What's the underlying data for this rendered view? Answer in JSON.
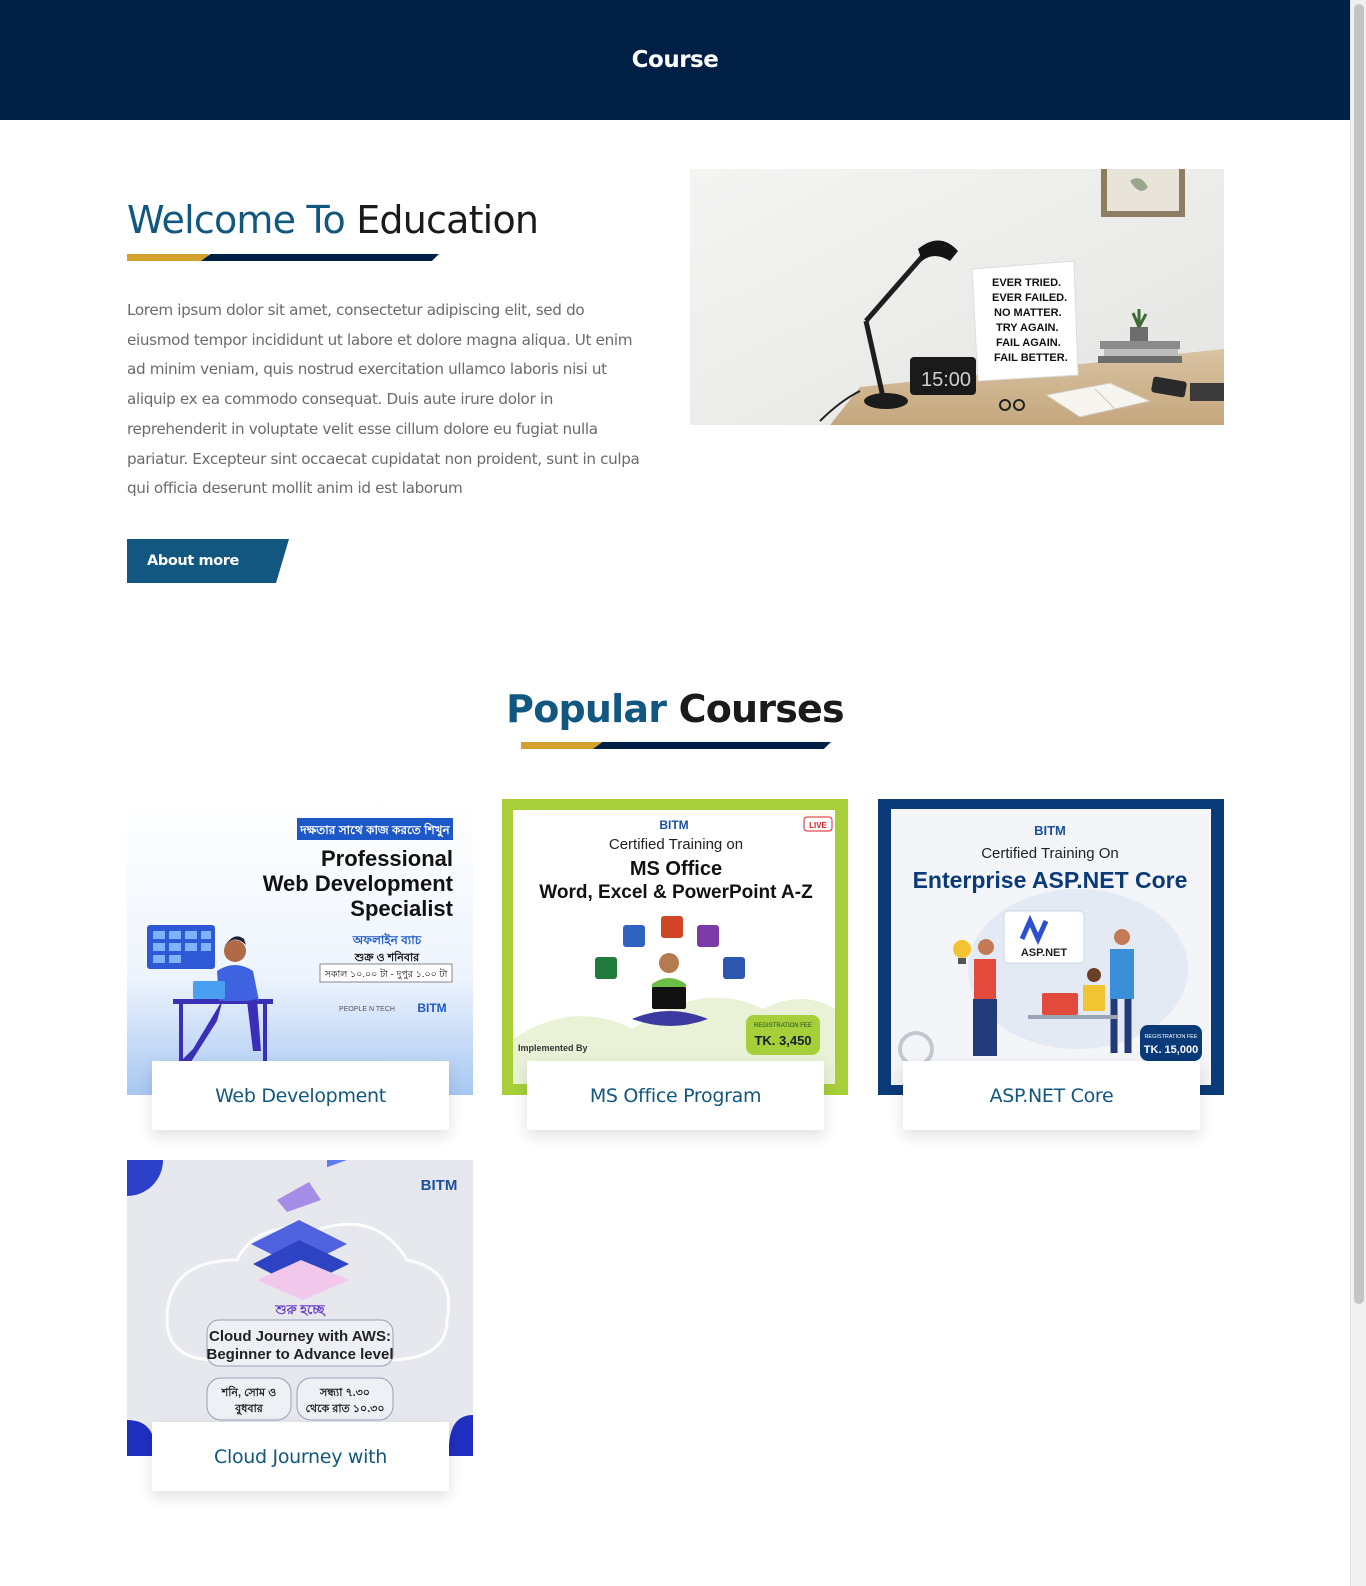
{
  "header": {
    "title": "Course"
  },
  "welcome": {
    "title_accent": "Welcome To",
    "title_rest": "Education",
    "body": "Lorem ipsum dolor sit amet, consectetur adipiscing elit, sed do eiusmod tempor incididunt ut labore et dolore magna aliqua. Ut enim ad minim veniam, quis nostrud exercitation ullamco laboris nisi ut aliquip ex ea commodo consequat. Duis aute irure dolor in reprehenderit in voluptate velit esse cillum dolore eu fugiat nulla pariatur. Excepteur sint occaecat cupidatat non proident, sunt in culpa qui officia deserunt mollit anim id est laborum",
    "button_label": "About more",
    "image": {
      "poster_lines": [
        "EVER TRIED.",
        "EVER FAILED.",
        "NO MATTER.",
        "TRY AGAIN.",
        "FAIL AGAIN.",
        "FAIL BETTER."
      ],
      "clock": "15:00"
    }
  },
  "popular": {
    "title_accent": "Popular",
    "title_rest": "Courses"
  },
  "courses": [
    {
      "label": "Web Development",
      "poster": {
        "tagline": "দক্ষতার সাথে কাজ করতে শিখুন",
        "line1": "Professional",
        "line2": "Web Development",
        "line3": "Specialist",
        "batch": "অফলাইন ব্যাচ",
        "days": "শুক্র ও শনিবার",
        "time": "সকাল ১০.০০ টা - দুপুর ১.০০ টা",
        "partner": "PEOPLE N TECH",
        "brand": "BITM"
      }
    },
    {
      "label": "MS Office Program",
      "poster": {
        "brand": "BITM",
        "live": "LIVE",
        "line1": "Certified Training on",
        "line2": "MS Office",
        "line3": "Word, Excel & PowerPoint A-Z",
        "fee_label": "REGISTRATION FEE",
        "fee": "TK. 3,450",
        "implemented": "Implemented By"
      }
    },
    {
      "label": "ASP.NET Core",
      "poster": {
        "brand": "BITM",
        "line1": "Certified Training On",
        "line2": "Enterprise ASP.NET Core",
        "logo": "ASP.NET",
        "fee_label": "REGISTRATION FEE",
        "fee": "TK. 15,000"
      }
    },
    {
      "label": "Cloud Journey with",
      "poster": {
        "brand": "BITM",
        "starting": "শুরু হচ্ছে",
        "line1": "Cloud Journey with AWS:",
        "line2": "Beginner to Advance level",
        "days1": "শনি, সোম ও",
        "days2": "বুধবার",
        "time1": "সন্ধ্যা ৭.৩০",
        "time2": "থেকে রাত ১০.৩০"
      }
    }
  ],
  "colors": {
    "navy": "#001f45",
    "accent_blue": "#11577f",
    "gold": "#d3a12d",
    "body_text": "#6b6b6b"
  }
}
